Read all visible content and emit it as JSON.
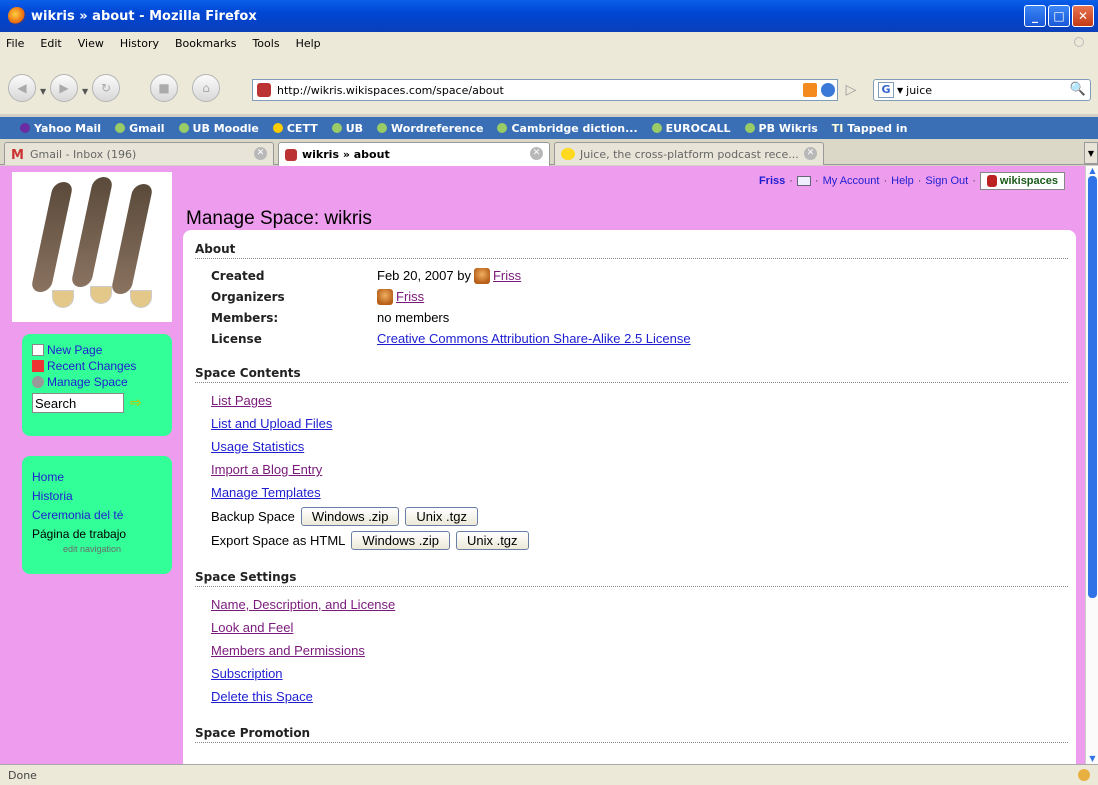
{
  "window": {
    "title": "wikris » about - Mozilla Firefox"
  },
  "menu": [
    "File",
    "Edit",
    "View",
    "History",
    "Bookmarks",
    "Tools",
    "Help"
  ],
  "url": "http://wikris.wikispaces.com/space/about",
  "search_value": "juice",
  "bookmarks": [
    "Yahoo Mail",
    "Gmail",
    "UB Moodle",
    "CETT",
    "UB",
    "Wordreference",
    "Cambridge diction...",
    "EUROCALL",
    "PB Wikris",
    "Tapped in"
  ],
  "tabs": [
    {
      "label": "Gmail - Inbox (196)"
    },
    {
      "label": "wikris » about"
    },
    {
      "label": "Juice, the cross-platform podcast rece..."
    }
  ],
  "sidebar": {
    "actions": {
      "new_page": "New Page",
      "recent_changes": "Recent Changes",
      "manage_space": "Manage Space"
    },
    "search_placeholder": "Search",
    "nav": [
      "Home",
      "Historia",
      "Ceremonia del té",
      "Página de trabajo"
    ],
    "edit_nav": "edit navigation"
  },
  "userbar": {
    "user": "Friss",
    "my_account": "My Account",
    "help": "Help",
    "sign_out": "Sign Out",
    "brand": "wikispaces",
    "sep": "·"
  },
  "page_title": "Manage Space: wikris",
  "about": {
    "heading": "About",
    "created_label": "Created",
    "created_value": "Feb 20, 2007 by",
    "created_user": "Friss",
    "organizers_label": "Organizers",
    "organizers_user": "Friss",
    "members_label": "Members:",
    "members_value": "no members",
    "license_label": "License",
    "license_value": "Creative Commons Attribution Share-Alike 2.5 License"
  },
  "space_contents": {
    "heading": "Space Contents",
    "links": [
      "List Pages",
      "List and Upload Files",
      "Usage Statistics",
      "Import a Blog Entry",
      "Manage Templates"
    ],
    "backup_label": "Backup Space",
    "export_label": "Export Space as HTML",
    "windows_zip": "Windows .zip",
    "unix_tgz": "Unix .tgz"
  },
  "space_settings": {
    "heading": "Space Settings",
    "links": [
      "Name, Description, and License",
      "Look and Feel",
      "Members and Permissions",
      "Subscription",
      "Delete this Space"
    ]
  },
  "space_promotion": {
    "heading": "Space Promotion"
  },
  "status": "Done"
}
